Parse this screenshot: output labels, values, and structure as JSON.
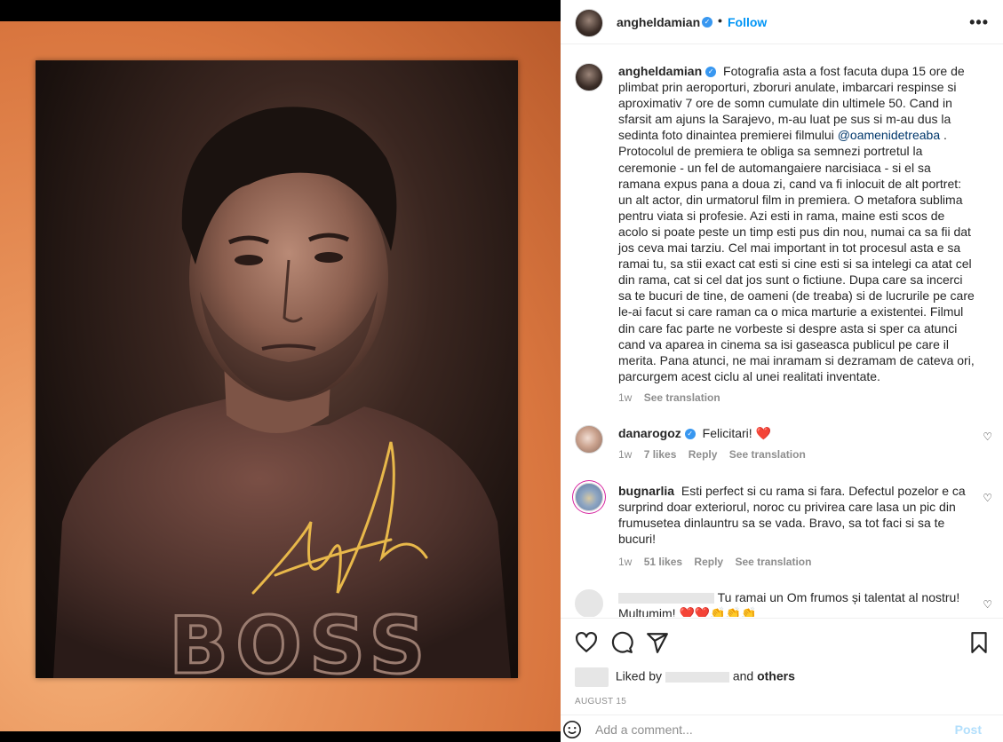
{
  "post": {
    "username": "angheldamian",
    "follow_label": "Follow",
    "dot": "•",
    "more_label": "•••"
  },
  "caption": {
    "username": "angheldamian",
    "text_before_mention": "Fotografia asta a fost facuta dupa 15 ore de plimbat prin aeroporturi, zboruri anulate, imbarcari respinse si aproximativ 7 ore de somn cumulate din ultimele 50. Cand in sfarsit am ajuns la Sarajevo, m-au luat pe sus si m-au dus la sedinta foto dinaintea premierei filmului",
    "mention": "@oamenidetreaba",
    "text_after_mention": ". Protocolul de premiera te obliga sa semnezi portretul la ceremonie - un fel de automangaiere narcisiaca - si el sa ramana expus pana a doua zi, cand va fi inlocuit de alt portret: un alt actor, din urmatorul film in premiera. O metafora sublima pentru viata si profesie. Azi esti in rama, maine esti scos de acolo si poate peste un timp esti pus din nou, numai ca sa fii dat jos ceva mai tarziu. Cel mai important in tot procesul asta e sa ramai tu, sa stii exact cat esti si cine esti si sa intelegi ca atat cel din rama, cat si cel dat jos sunt o fictiune. Dupa care sa incerci sa te bucuri de tine, de oameni (de treaba) si de lucrurile pe care le-ai facut si care raman ca o mica marturie a existentei. Filmul din care fac parte ne vorbeste si despre asta si sper ca atunci cand va aparea in cinema sa isi gaseasca publicul pe care il merita. Pana atunci, ne mai inramam si dezramam de cateva ori, parcurgem acest ciclu al unei realitati inventate.",
    "time": "1w",
    "see_translation": "See translation"
  },
  "comments": [
    {
      "username": "danarogoz",
      "text": "Felicitari!",
      "emoji": "❤️",
      "time": "1w",
      "likes": "7 likes",
      "reply": "Reply",
      "see_translation": "See translation"
    },
    {
      "username": "bugnarlia",
      "text": "Esti perfect si cu rama si fara. Defectul pozelor e ca surprind doar exteriorul, noroc cu privirea care lasa un pic din frumusetea dinlauntru sa se vada. Bravo, sa tot faci si sa te bucuri!",
      "time": "1w",
      "likes": "51 likes",
      "reply": "Reply",
      "see_translation": "See translation"
    },
    {
      "text": "Tu ramai un Om frumos și talentat al nostru!",
      "text2": "Multumim! ❤️❤️👏👏👏"
    }
  ],
  "actions": {
    "liked_prefix": "Liked by",
    "liked_and": "and",
    "liked_others": "others",
    "date": "AUGUST 15",
    "comment_placeholder": "Add a comment...",
    "post_label": "Post"
  },
  "icons": {
    "verified": "verified-badge-icon",
    "heart": "heart-icon",
    "comment": "comment-icon",
    "share": "share-icon",
    "bookmark": "bookmark-icon",
    "emoji": "emoji-icon"
  },
  "colors": {
    "link": "#0095f6",
    "mention": "#00376b",
    "verified": "#3897f0",
    "post_disabled": "#b2dffc",
    "heart_red": "#ed4956"
  }
}
